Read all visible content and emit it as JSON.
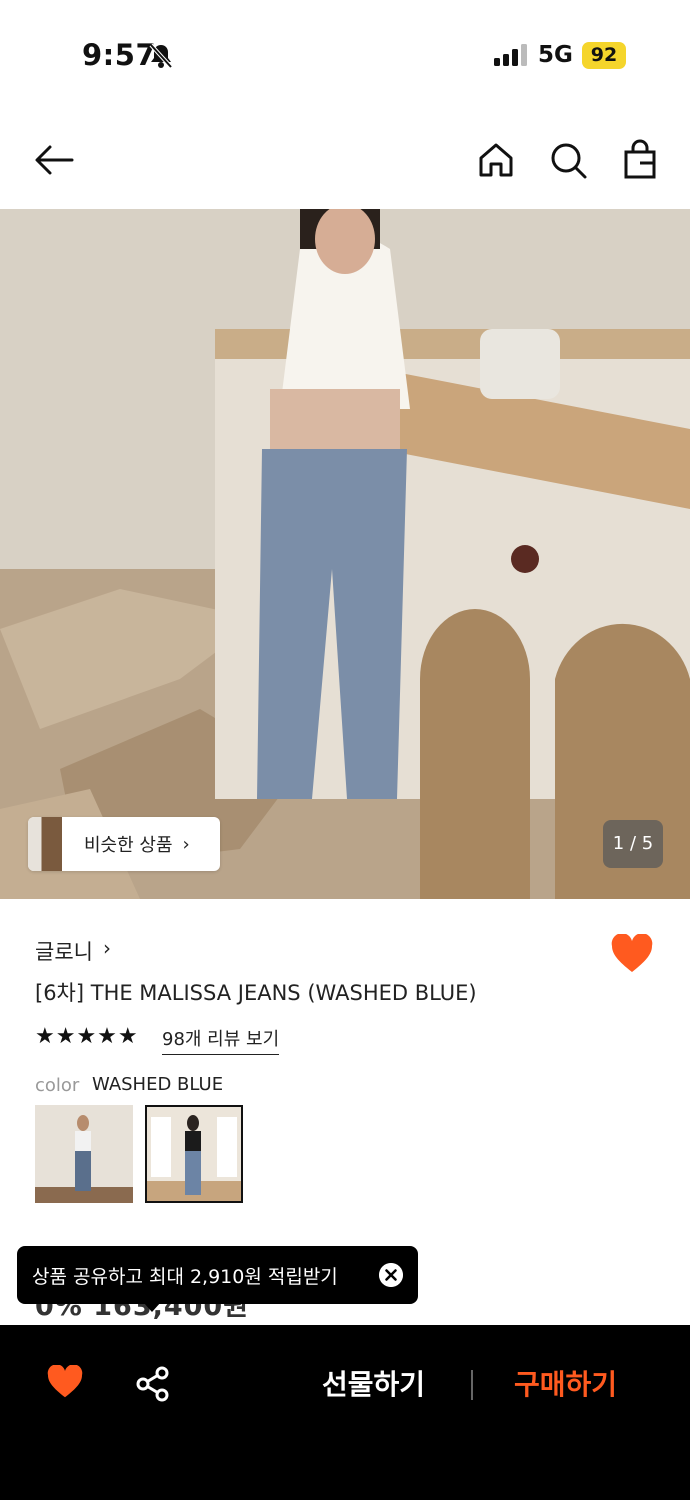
{
  "status_bar": {
    "time": "9:57",
    "network": "5G",
    "battery": "92",
    "icons": [
      "bell-muted-icon",
      "signal-icon"
    ]
  },
  "nav": {
    "icons": [
      "back-arrow-icon",
      "home-icon",
      "search-icon",
      "shopping-bag-icon"
    ]
  },
  "gallery": {
    "similar_label": "비슷한 상품",
    "similar_chevron": "›",
    "pager": "1 / 5"
  },
  "product": {
    "brand": "글로니",
    "brand_chevron": "›",
    "title": "[6차] THE MALISSA JEANS (WASHED BLUE)",
    "stars": "★★★★★",
    "review_link": "98개 리뷰 보기",
    "color_key": "color",
    "color_value": "WASHED BLUE",
    "price_peek": "0% 163,400원",
    "wish_color": "#ff5a1f"
  },
  "toast": {
    "text": "상품 공유하고 최대 2,910원 적립받기"
  },
  "bottom_bar": {
    "gift_label": "선물하기",
    "buy_label": "구매하기",
    "accent": "#ff5a1f"
  }
}
